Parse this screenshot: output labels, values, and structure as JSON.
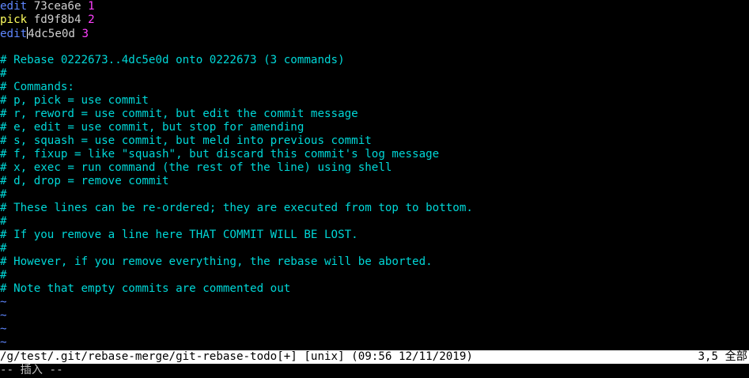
{
  "todo": [
    {
      "command": "edit",
      "hash": "73cea6e",
      "num": "1"
    },
    {
      "command": "pick",
      "hash": "fd9f8b4",
      "num": "2"
    },
    {
      "command": "edit",
      "hash": "4dc5e0d",
      "num": "3"
    }
  ],
  "comments": [
    "",
    "# Rebase 0222673..4dc5e0d onto 0222673 (3 commands)",
    "#",
    "# Commands:",
    "# p, pick = use commit",
    "# r, reword = use commit, but edit the commit message",
    "# e, edit = use commit, but stop for amending",
    "# s, squash = use commit, but meld into previous commit",
    "# f, fixup = like \"squash\", but discard this commit's log message",
    "# x, exec = run command (the rest of the line) using shell",
    "# d, drop = remove commit",
    "#",
    "# These lines can be re-ordered; they are executed from top to bottom.",
    "#",
    "# If you remove a line here THAT COMMIT WILL BE LOST.",
    "#",
    "# However, if you remove everything, the rebase will be aborted.",
    "#",
    "# Note that empty commits are commented out"
  ],
  "tildes": [
    "~",
    "~",
    "~",
    "~"
  ],
  "status": {
    "file_info": "/g/test/.git/rebase-merge/git-rebase-todo[+] [unix] (09:56 12/11/2019)",
    "position": "3,5 全部"
  },
  "mode_line": "-- 插入 --",
  "colors": {
    "background": "#000000",
    "comment": "#00d7d7",
    "edit_command": "#5f87ff",
    "pick_command": "#ffff5f",
    "number": "#ff40ff",
    "tilde": "#5f87ff",
    "statusline_bg": "#ffffff"
  }
}
